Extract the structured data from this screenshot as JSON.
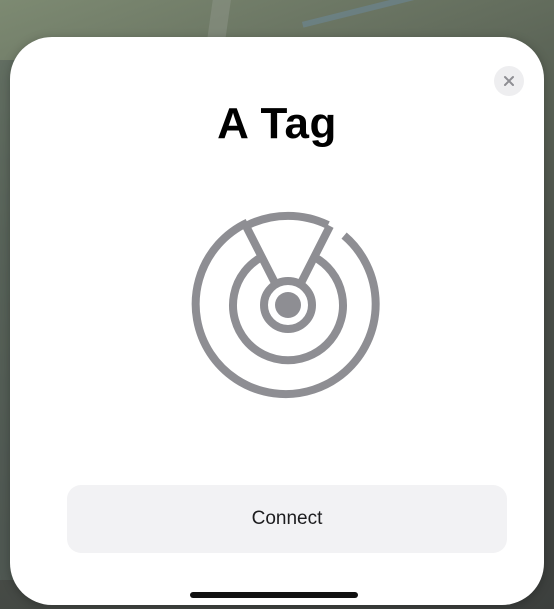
{
  "sheet": {
    "title": "A Tag",
    "connect_label": "Connect"
  },
  "icons": {
    "close": "close-icon",
    "device": "tag-radar-icon"
  },
  "colors": {
    "sheet_bg": "#ffffff",
    "button_bg": "#f2f2f4",
    "icon_gray": "#8e8e93"
  }
}
